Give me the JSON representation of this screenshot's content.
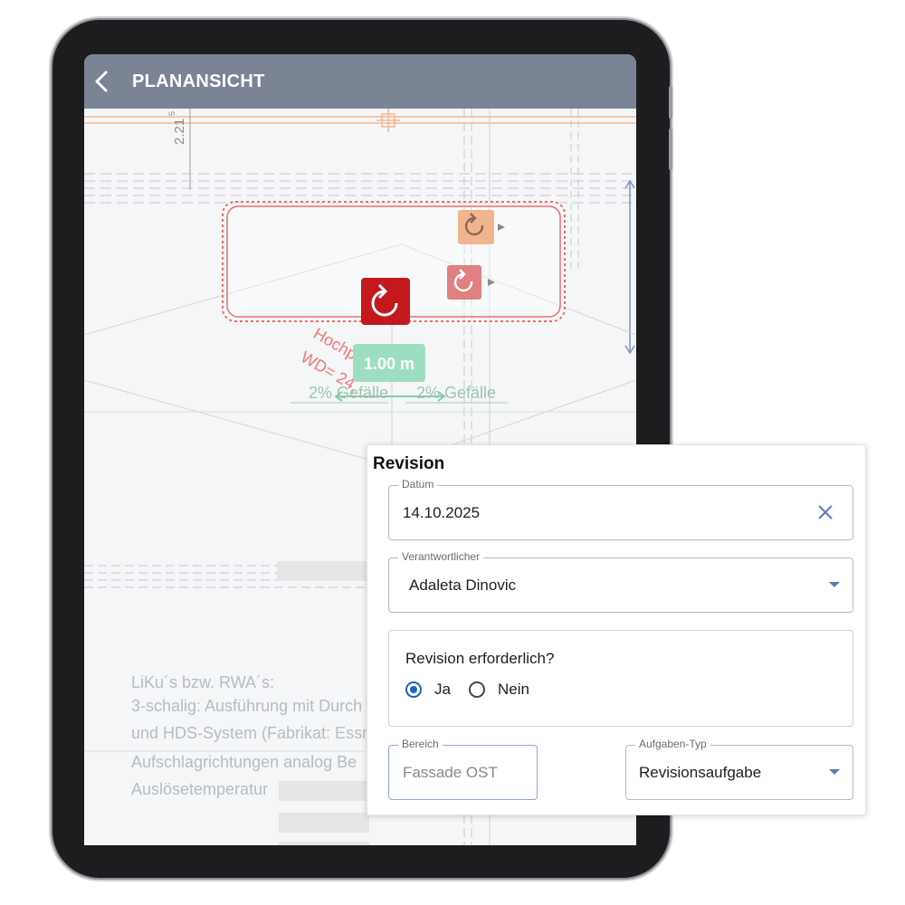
{
  "appbar": {
    "title": "PLANANSICHT",
    "back_icon": "chevron-left-icon"
  },
  "plan": {
    "dimension_vertical": "2.21",
    "dimension_sup": "5",
    "measure_badge": "1.00 m",
    "slope_left": "2% Gefälle",
    "slope_right": "2% Gefälle",
    "red_annotation_1": "Hochp",
    "red_annotation_2": "WD= 24,",
    "notes": [
      "LiKu´s bzw. RWA´s:",
      "3-schalig: Ausführung mit Durch",
      "und HDS-System (Fabrikat: Essm",
      "Aufschlagrichtungen analog Be",
      "Auslösetemperatur"
    ],
    "markers": [
      {
        "name": "revision-marker-orange",
        "color": "#f0b58e",
        "icon": "rotate-icon"
      },
      {
        "name": "revision-marker-pink",
        "color": "#e08080",
        "icon": "rotate-icon"
      },
      {
        "name": "revision-marker-active",
        "color": "#c3181c",
        "icon": "rotate-icon"
      }
    ]
  },
  "revision": {
    "title": "Revision",
    "datum": {
      "label": "Datum",
      "value": "14.10.2025"
    },
    "verantwortlicher": {
      "label": "Verantwortlicher",
      "value": "Adaleta Dinovic"
    },
    "required": {
      "question": "Revision erforderlich?",
      "options": [
        "Ja",
        "Nein"
      ],
      "selected": "Ja"
    },
    "bereich": {
      "label": "Bereich",
      "placeholder": "Fassade OST"
    },
    "aufgaben_typ": {
      "label": "Aufgaben-Typ",
      "value": "Revisionsaufgabe"
    }
  },
  "colors": {
    "appbar": "#7b8494",
    "accent": "#1565c0",
    "cloud": "#f06b6b",
    "badge": "#9edec0"
  }
}
